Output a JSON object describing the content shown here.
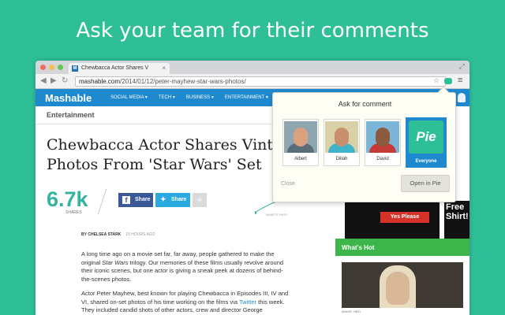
{
  "headline": "Ask your team for their comments",
  "browser": {
    "tab_title": "Chewbacca Actor Shares V",
    "tab_favicon": "M",
    "url_domain": "mashable.com",
    "url_path": "/2014/01/12/peter-mayhew-star-wars-photos/",
    "traffic_lights": [
      "#ed6b60",
      "#f5c04f",
      "#62c655"
    ]
  },
  "site": {
    "logo": "Mashable",
    "nav": [
      "SOCIAL MEDIA ▾",
      "TECH ▾",
      "BUSINESS ▾",
      "ENTERTAINMENT ▾"
    ],
    "accent_color": "#1f89d0"
  },
  "article": {
    "category": "Entertainment",
    "title_line1": "Chewbacca Actor Shares Vintag",
    "title_line2": "Photos From 'Star Wars' Set",
    "shares": "6.7k",
    "shares_label": "SHARES",
    "fb_label": "Share",
    "tw_label": "Share",
    "plus_label": "+",
    "whats_this": "WHAT'S THIS?",
    "author_prefix": "BY",
    "author": "CHELSEA STARK",
    "time_ago": "15 HOURS AGO",
    "p1_a": "A long time ago on a movie set far, far away, people gathered to make the original ",
    "p1_em": "Star Wars",
    "p1_b": " trilogy. Our memories of these films usually revolve around their iconic scenes, but one actor is giving a sneak peek at dozens of behind-the-scenes photos.",
    "p2_a": "Actor Peter Mayhew, best known for playing Chewbacca in Episodes III, IV and VI, shared on-set photos of his time working on the films via ",
    "p2_link": "Twitter",
    "p2_b": " this week. They included candid shots of other actors, crew and director George"
  },
  "sidebar": {
    "ad_button": "Yes Please",
    "ad_text": "Free Shirt!",
    "whats_hot": "What's Hot",
    "hot_caption": "IMAGE: HBO"
  },
  "popup": {
    "title": "Ask for comment",
    "people": [
      {
        "name": "Albert",
        "skin": "#d9a27d",
        "shirt": "#5a6e7a",
        "bg": "#8fa6b0"
      },
      {
        "name": "Dillah",
        "skin": "#c98e6c",
        "shirt": "#3fb3c9",
        "bg": "#d9d0a8"
      },
      {
        "name": "David",
        "skin": "#8c5a3c",
        "shirt": "#c43b37",
        "bg": "#7bb6d8"
      }
    ],
    "everyone_logo": "Pie",
    "everyone_label": "Everyone",
    "close_label": "Close",
    "open_label": "Open in Pie"
  }
}
